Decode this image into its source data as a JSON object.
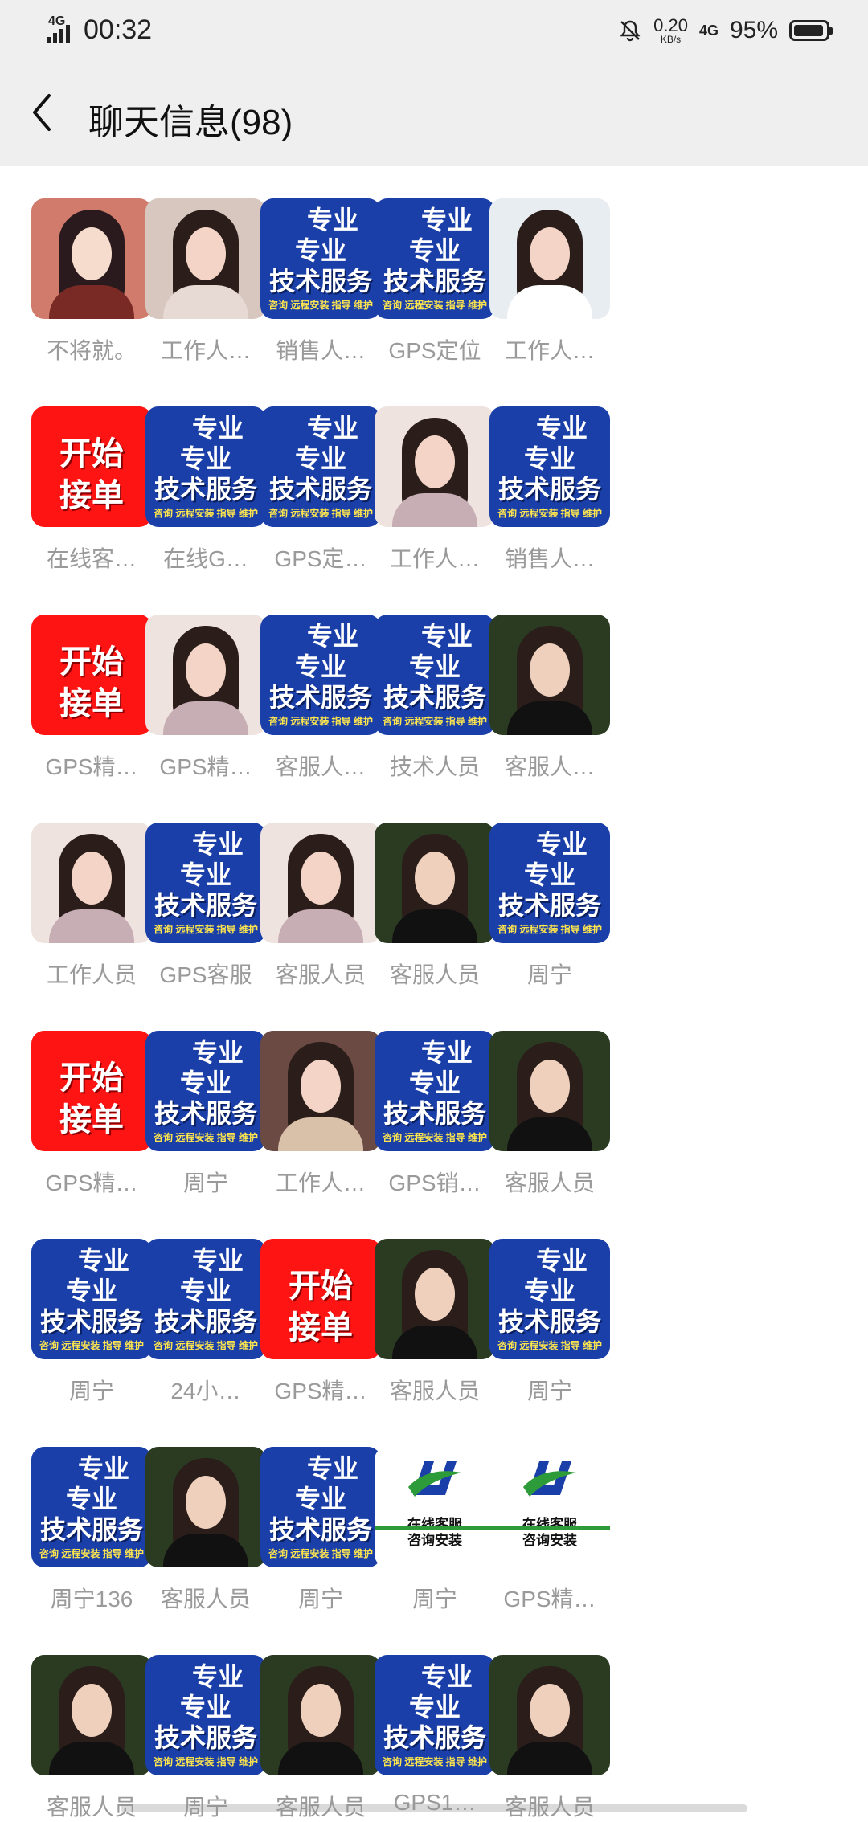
{
  "status_bar": {
    "network_left": "4G",
    "time": "00:32",
    "speed_value": "0.20",
    "speed_unit": "KB/s",
    "network_right": "4G",
    "battery_percent": "95%",
    "battery_level": 0.95
  },
  "nav": {
    "back_icon": "chevron-left-icon",
    "title": "聊天信息(98)"
  },
  "colors": {
    "service_blue": "#1b3fa9",
    "order_red": "#ff1414",
    "name_gray": "#9a9a9a",
    "header_bg": "#efefef"
  },
  "avatar_text": {
    "service": [
      "专业",
      "专业",
      "技术服务",
      "咨询 远程安装 指导 维护"
    ],
    "order": [
      "开始",
      "接单"
    ],
    "logo": [
      "在线客服",
      "咨询安装"
    ]
  },
  "members": [
    {
      "name": "不将就。",
      "avatar": "anime"
    },
    {
      "name": "工作人…",
      "avatar": "photo-a"
    },
    {
      "name": "销售人…",
      "avatar": "service"
    },
    {
      "name": "GPS定位",
      "avatar": "service"
    },
    {
      "name": "工作人…",
      "avatar": "photo-b"
    },
    {
      "name": "在线客…",
      "avatar": "order"
    },
    {
      "name": "在线G…",
      "avatar": "service"
    },
    {
      "name": "GPS定…",
      "avatar": "service"
    },
    {
      "name": "工作人…",
      "avatar": "photo-c"
    },
    {
      "name": "销售人…",
      "avatar": "service"
    },
    {
      "name": "GPS精…",
      "avatar": "order"
    },
    {
      "name": "GPS精…",
      "avatar": "photo-c"
    },
    {
      "name": "客服人…",
      "avatar": "service"
    },
    {
      "name": "技术人员",
      "avatar": "service"
    },
    {
      "name": "客服人…",
      "avatar": "photo-d"
    },
    {
      "name": "工作人员",
      "avatar": "photo-c"
    },
    {
      "name": "GPS客服",
      "avatar": "service"
    },
    {
      "name": "客服人员",
      "avatar": "photo-c"
    },
    {
      "name": "客服人员",
      "avatar": "photo-d"
    },
    {
      "name": "周宁",
      "avatar": "service"
    },
    {
      "name": "GPS精…",
      "avatar": "order"
    },
    {
      "name": "周宁",
      "avatar": "service"
    },
    {
      "name": "工作人…",
      "avatar": "photo-e"
    },
    {
      "name": "GPS销…",
      "avatar": "service"
    },
    {
      "name": "客服人员",
      "avatar": "photo-d"
    },
    {
      "name": "周宁",
      "avatar": "service"
    },
    {
      "name": "24小…",
      "avatar": "service"
    },
    {
      "name": "GPS精…",
      "avatar": "order"
    },
    {
      "name": "客服人员",
      "avatar": "photo-d"
    },
    {
      "name": "周宁",
      "avatar": "service"
    },
    {
      "name": "周宁136",
      "avatar": "service"
    },
    {
      "name": "客服人员",
      "avatar": "photo-d"
    },
    {
      "name": "周宁",
      "avatar": "service"
    },
    {
      "name": "周宁",
      "avatar": "logo"
    },
    {
      "name": "GPS精…",
      "avatar": "logo"
    },
    {
      "name": "客服人员",
      "avatar": "photo-d"
    },
    {
      "name": "周宁",
      "avatar": "service"
    },
    {
      "name": "客服人员",
      "avatar": "photo-d"
    },
    {
      "name": "GPS1…",
      "avatar": "service"
    },
    {
      "name": "客服人员",
      "avatar": "photo-d"
    }
  ]
}
